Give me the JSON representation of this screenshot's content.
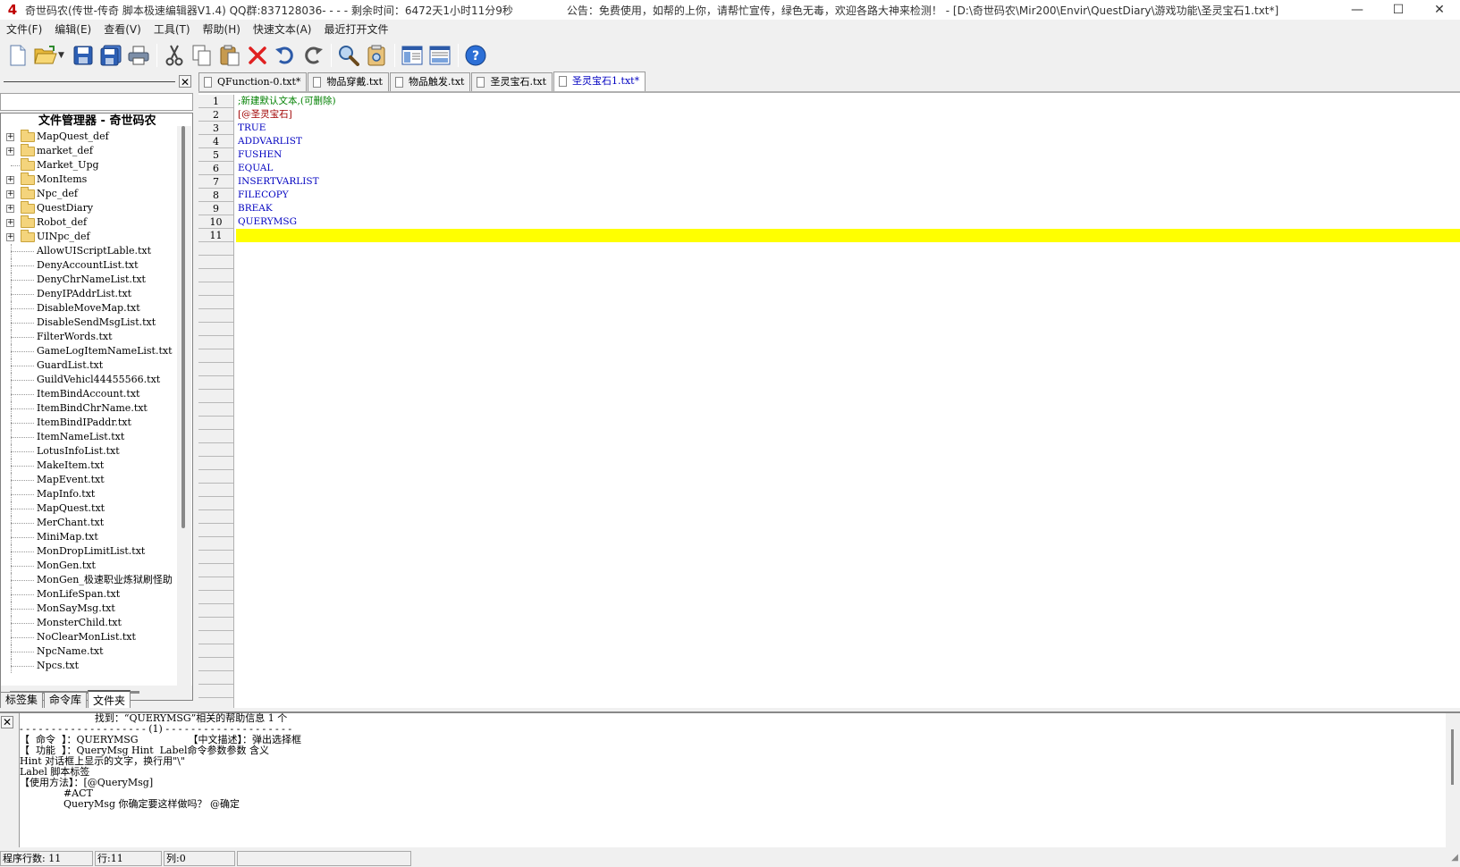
{
  "titlebar": {
    "icon_glyph": "4",
    "title": "奇世码农(传世-传奇 脚本极速编辑器V1.4) QQ群:837128036- - - - 剩余时间：6472天1小时11分9秒",
    "notice": "公告：免费使用，如帮的上你，请帮忙宣传，绿色无毒，欢迎各路大神来检测！ - [D:\\奇世码农\\Mir200\\Envir\\QuestDiary\\游戏功能\\圣灵宝石1.txt*]",
    "minimize": "—",
    "maximize": "☐",
    "close": "✕"
  },
  "menu": [
    "文件(F)",
    "编辑(E)",
    "查看(V)",
    "工具(T)",
    "帮助(H)",
    "快速文本(A)",
    "最近打开文件"
  ],
  "toolbar": {
    "icons": [
      "new-file-icon",
      "open-folder-icon",
      "save-icon",
      "save-all-icon",
      "print-icon",
      "cut-icon",
      "copy-icon",
      "paste-icon",
      "delete-icon",
      "undo-icon",
      "redo-icon",
      "find-icon",
      "find-replace-icon",
      "panel-left-icon",
      "panel-bottom-icon",
      "help-icon"
    ],
    "dropdown": "▼"
  },
  "left_panel": {
    "close": "✕",
    "tree_root": "文件管理器 - 奇世码农",
    "folders": [
      "MapQuest_def",
      "market_def",
      "Market_Upg",
      "MonItems",
      "Npc_def",
      "QuestDiary",
      "Robot_def",
      "UINpc_def"
    ],
    "files": [
      "AllowUIScriptLable.txt",
      "DenyAccountList.txt",
      "DenyChrNameList.txt",
      "DenyIPAddrList.txt",
      "DisableMoveMap.txt",
      "DisableSendMsgList.txt",
      "FilterWords.txt",
      "GameLogItemNameList.txt",
      "GuardList.txt",
      "GuildVehicl44455566.txt",
      "ItemBindAccount.txt",
      "ItemBindChrName.txt",
      "ItemBindIPaddr.txt",
      "ItemNameList.txt",
      "LotusInfoList.txt",
      "MakeItem.txt",
      "MapEvent.txt",
      "MapInfo.txt",
      "MapQuest.txt",
      "MerChant.txt",
      "MiniMap.txt",
      "MonDropLimitList.txt",
      "MonGen.txt",
      "MonGen_极速职业炼狱刷怪助",
      "MonLifeSpan.txt",
      "MonSayMsg.txt",
      "MonsterChild.txt",
      "NoClearMonList.txt",
      "NpcName.txt",
      "Npcs.txt"
    ],
    "tabs": [
      "标签集",
      "命令库",
      "文件夹"
    ],
    "active_tab": 2
  },
  "editor": {
    "tabs": [
      "QFunction-0.txt*",
      "物品穿戴.txt",
      "物品触发.txt",
      "圣灵宝石.txt",
      "圣灵宝石1.txt*"
    ],
    "active_tab": 4,
    "lines": [
      {
        "n": "1",
        "text": ";新建默认文本,(可删除)",
        "kind": "comment"
      },
      {
        "n": "2",
        "text": "[@圣灵宝石]",
        "kind": "label"
      },
      {
        "n": "3",
        "text": "TRUE",
        "kind": "kw"
      },
      {
        "n": "4",
        "text": "ADDVARLIST",
        "kind": "kw"
      },
      {
        "n": "5",
        "text": "FUSHEN",
        "kind": "kw"
      },
      {
        "n": "6",
        "text": "EQUAL",
        "kind": "kw"
      },
      {
        "n": "7",
        "text": "INSERTVARLIST",
        "kind": "kw"
      },
      {
        "n": "8",
        "text": "FILECOPY",
        "kind": "kw"
      },
      {
        "n": "9",
        "text": "BREAK",
        "kind": "kw"
      },
      {
        "n": "10",
        "text": "QUERYMSG",
        "kind": "kw"
      },
      {
        "n": "11",
        "text": "",
        "kind": "current"
      }
    ],
    "highlight_color": "#ffff00"
  },
  "help": {
    "close": "✕",
    "lines": [
      "                        找到：“QUERYMSG”相关的帮助信息 1 个",
      "- - - - - - - - - - - - - - - - - - - - (1) - - - - - - - - - - - - - - - - - - - -",
      "【  命令  】：QUERYMSG                【中文描述】：弹出选择框",
      "【  功能  】：QueryMsg Hint  Label命令参数参数 含义",
      "Hint 对话框上显示的文字，换行用\"\\\"",
      "Label 脚本标签",
      "",
      "【使用方法】：[@QueryMsg]",
      "              #ACT",
      "              QueryMsg 你确定要这样做吗？ @确定"
    ]
  },
  "status": {
    "program_lines": "程序行数: 11",
    "row": "行:11",
    "col": "列:0",
    "extra": ""
  }
}
